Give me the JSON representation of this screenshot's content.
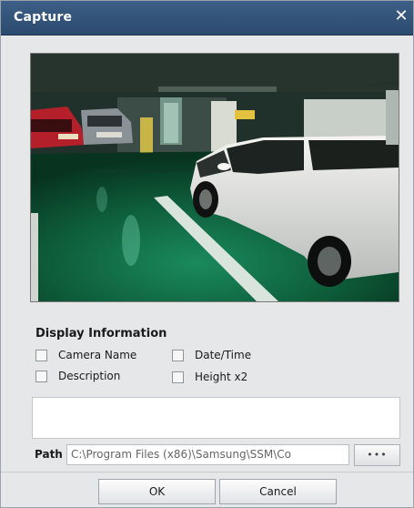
{
  "window": {
    "title": "Capture"
  },
  "display_info": {
    "title": "Display Information",
    "options": {
      "camera_name": "Camera Name",
      "date_time": "Date/Time",
      "description": "Description",
      "height_x2": "Height x2"
    }
  },
  "path": {
    "label": "Path",
    "value": "C:\\Program Files (x86)\\Samsung\\SSM\\Co",
    "browse_label": "•••"
  },
  "buttons": {
    "ok": "OK",
    "cancel": "Cancel"
  },
  "icons": {
    "close": "close-icon",
    "browse": "ellipsis-icon"
  },
  "colors": {
    "titlebar": "#2f5178",
    "floor": "#0d5a38"
  }
}
